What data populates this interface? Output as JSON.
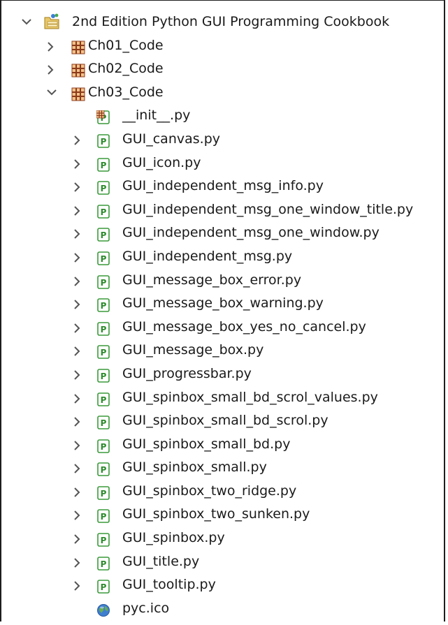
{
  "tree": {
    "root": {
      "label": "2nd Edition Python GUI Programming Cookbook",
      "icon": "pydev-project-icon",
      "expanded": true
    },
    "folders": [
      {
        "label": "Ch01_Code",
        "icon": "package-icon",
        "expanded": false
      },
      {
        "label": "Ch02_Code",
        "icon": "package-icon",
        "expanded": false
      },
      {
        "label": "Ch03_Code",
        "icon": "package-icon",
        "expanded": true
      }
    ],
    "files": [
      {
        "label": "__init__.py",
        "icon": "init-module-icon",
        "expandable": false
      },
      {
        "label": "GUI_canvas.py",
        "icon": "python-module-icon",
        "expandable": true
      },
      {
        "label": "GUI_icon.py",
        "icon": "python-module-icon",
        "expandable": true
      },
      {
        "label": "GUI_independent_msg_info.py",
        "icon": "python-module-icon",
        "expandable": true
      },
      {
        "label": "GUI_independent_msg_one_window_title.py",
        "icon": "python-module-icon",
        "expandable": true
      },
      {
        "label": "GUI_independent_msg_one_window.py",
        "icon": "python-module-icon",
        "expandable": true
      },
      {
        "label": "GUI_independent_msg.py",
        "icon": "python-module-icon",
        "expandable": true
      },
      {
        "label": "GUI_message_box_error.py",
        "icon": "python-module-icon",
        "expandable": true
      },
      {
        "label": "GUI_message_box_warning.py",
        "icon": "python-module-icon",
        "expandable": true
      },
      {
        "label": "GUI_message_box_yes_no_cancel.py",
        "icon": "python-module-icon",
        "expandable": true
      },
      {
        "label": "GUI_message_box.py",
        "icon": "python-module-icon",
        "expandable": true
      },
      {
        "label": "GUI_progressbar.py",
        "icon": "python-module-icon",
        "expandable": true
      },
      {
        "label": "GUI_spinbox_small_bd_scrol_values.py",
        "icon": "python-module-icon",
        "expandable": true
      },
      {
        "label": "GUI_spinbox_small_bd_scrol.py",
        "icon": "python-module-icon",
        "expandable": true
      },
      {
        "label": "GUI_spinbox_small_bd.py",
        "icon": "python-module-icon",
        "expandable": true
      },
      {
        "label": "GUI_spinbox_small.py",
        "icon": "python-module-icon",
        "expandable": true
      },
      {
        "label": "GUI_spinbox_two_ridge.py",
        "icon": "python-module-icon",
        "expandable": true
      },
      {
        "label": "GUI_spinbox_two_sunken.py",
        "icon": "python-module-icon",
        "expandable": true
      },
      {
        "label": "GUI_spinbox.py",
        "icon": "python-module-icon",
        "expandable": true
      },
      {
        "label": "GUI_title.py",
        "icon": "python-module-icon",
        "expandable": true
      },
      {
        "label": "GUI_tooltip.py",
        "icon": "python-module-icon",
        "expandable": true
      },
      {
        "label": "pyc.ico",
        "icon": "globe-icon",
        "expandable": false
      }
    ]
  },
  "colors": {
    "module_green": "#3a9a3a",
    "package_brown": "#8b3a1a",
    "package_orange": "#e8a050",
    "arrow_gray": "#555555"
  }
}
